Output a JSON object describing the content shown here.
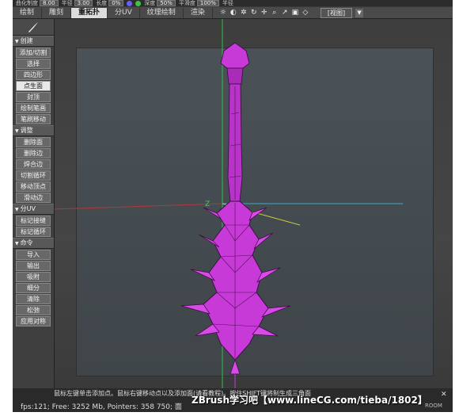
{
  "params": [
    {
      "label": "曲化制度",
      "value": "8.00"
    },
    {
      "label": "半径",
      "value": "3.00"
    },
    {
      "label": "长度",
      "value": "0%"
    },
    {
      "label": "深度",
      "value": "50%"
    },
    {
      "label": "平滑度",
      "value": "100%"
    },
    {
      "label": "半径",
      "value": ""
    }
  ],
  "tabs": [
    "绘制",
    "雕刻",
    "重拓扑",
    "分UV",
    "纹理绘制",
    "渲染"
  ],
  "active_tab": "重拓扑",
  "view_menu": "[视图]",
  "sections": [
    {
      "title": "创建",
      "items": [
        "添加/切割",
        "选择",
        "四边形",
        "点生面",
        "封顶",
        "绘制笔画",
        "笔刷移动"
      ],
      "selected": "点生面"
    },
    {
      "title": "调整",
      "items": [
        "删除面",
        "删除边",
        "焊合边",
        "切割循环",
        "移动顶点",
        "滑动边"
      ]
    },
    {
      "title": "分UV",
      "items": [
        "标记接缝",
        "标记循环"
      ]
    },
    {
      "title": "命令",
      "items": [
        "导入",
        "输出",
        "吸附",
        "细分",
        "清除",
        "松弛",
        "应用对称"
      ]
    }
  ],
  "status": {
    "hint": "鼠标左键单击添加点。鼠标右键移动点以及添加面(请看教程)。按住SHIFT键将制生成三角面",
    "stats": "fps:121;   Free: 3252 Mb, Pointers: 358 750; 面",
    "watermark": "ZBrush学习吧【www.lineCG.com/tieba/1802】",
    "room": "ROOM"
  },
  "axis_label": "Z",
  "colors": {
    "mesh": "#c83ad8",
    "mesh_dark": "#4a1050",
    "active_tab": "#dcdcdc"
  }
}
